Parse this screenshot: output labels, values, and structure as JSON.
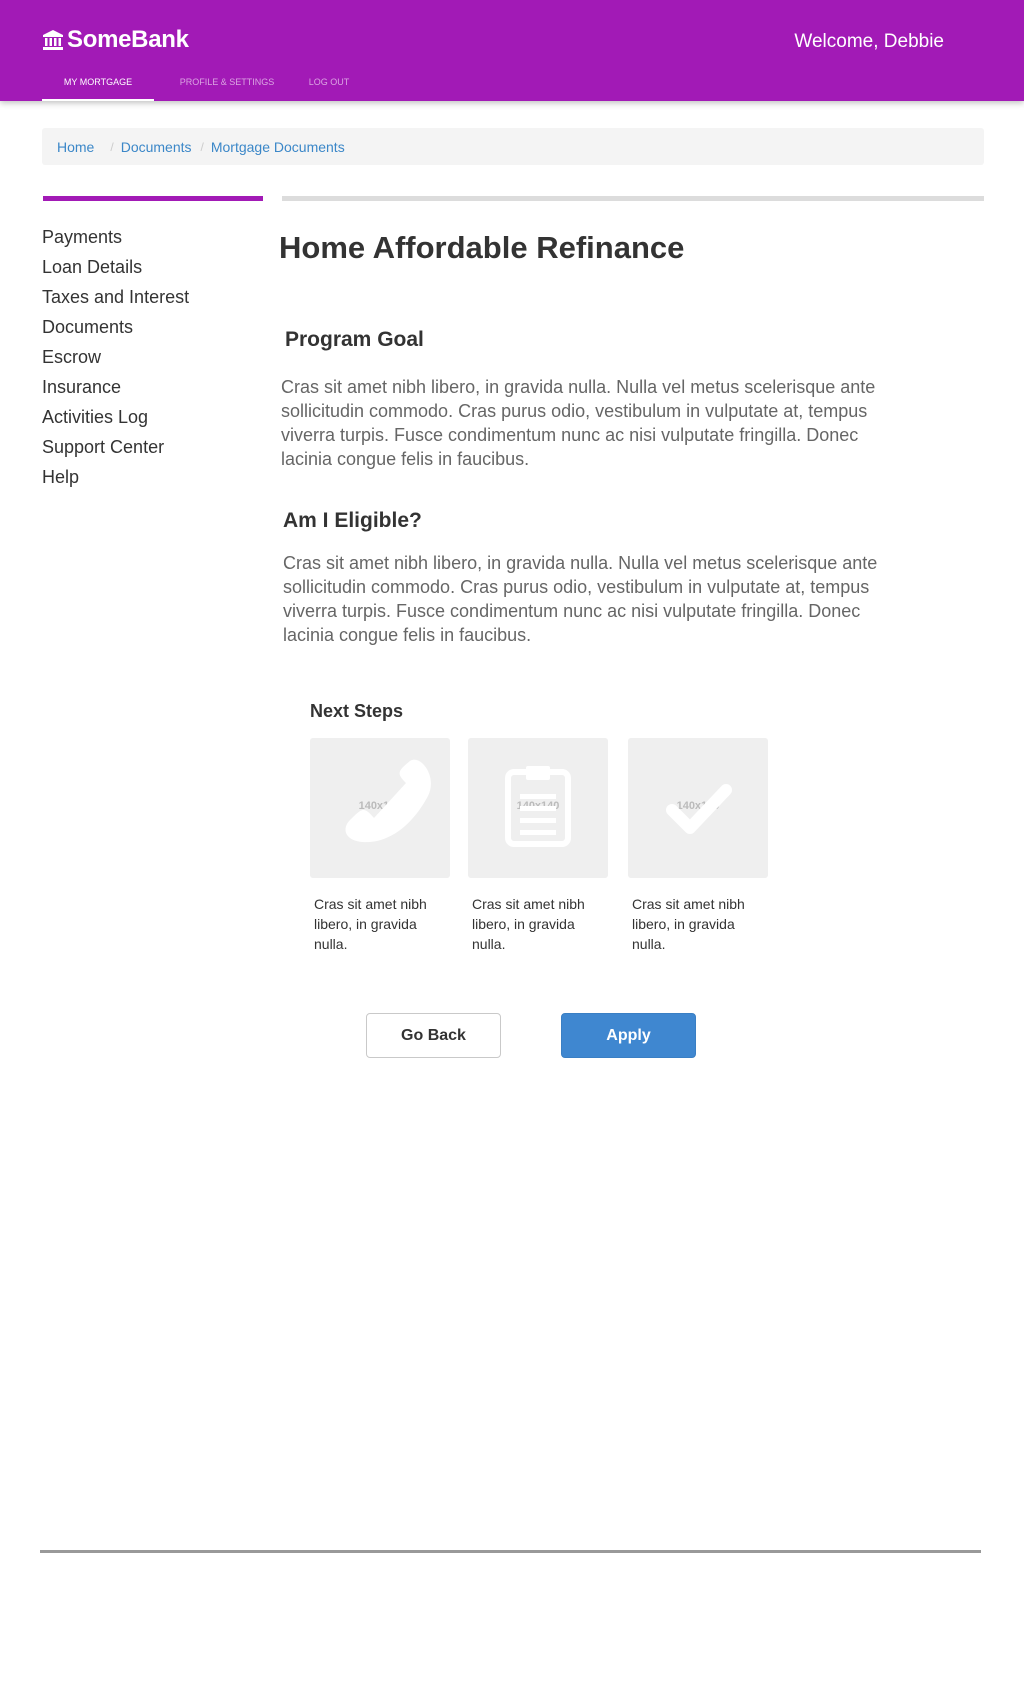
{
  "colors": {
    "brand": "#a21ab6",
    "link": "#3b87c8",
    "primary_button": "#3f87d0"
  },
  "header": {
    "brand_icon": "bank-icon",
    "brand_name": "SomeBank",
    "welcome": "Welcome, Debbie",
    "nav": [
      {
        "label": "MY MORTGAGE",
        "active": true
      },
      {
        "label": "PROFILE & SETTINGS",
        "active": false
      },
      {
        "label": "LOG OUT",
        "active": false
      }
    ]
  },
  "breadcrumb": [
    "Home",
    "Documents",
    "Mortgage Documents"
  ],
  "sidebar": {
    "items": [
      "Payments",
      "Loan Details",
      "Taxes and Interest",
      "Documents",
      "Escrow",
      "Insurance",
      "Activities Log",
      "Support Center",
      "Help"
    ]
  },
  "main": {
    "title": "Home Affordable Refinance",
    "sections": [
      {
        "title": "Program Goal",
        "body": "Cras sit amet nibh libero, in gravida nulla. Nulla vel metus scelerisque ante sollicitudin commodo. Cras purus odio, vestibulum in vulputate at, tempus viverra turpis. Fusce condimentum nunc ac nisi vulputate fringilla. Donec lacinia congue felis in faucibus."
      },
      {
        "title": "Am I Eligible?",
        "body": "Cras sit amet nibh libero, in gravida nulla. Nulla vel metus scelerisque ante sollicitudin commodo. Cras purus odio, vestibulum in vulputate at, tempus viverra turpis. Fusce condimentum nunc ac nisi vulputate fringilla. Donec lacinia congue felis in faucibus."
      }
    ],
    "next_steps": {
      "title": "Next Steps",
      "items": [
        {
          "icon": "phone-icon",
          "placeholder": "140x140",
          "text": "Cras sit amet nibh libero, in gravida nulla."
        },
        {
          "icon": "clipboard-icon",
          "placeholder": "140x140",
          "text": "Cras sit amet nibh libero, in gravida nulla."
        },
        {
          "icon": "checkmark-icon",
          "placeholder": "140x140",
          "text": "Cras sit amet nibh libero, in gravida nulla."
        }
      ]
    },
    "buttons": {
      "back": "Go Back",
      "apply": "Apply"
    }
  }
}
